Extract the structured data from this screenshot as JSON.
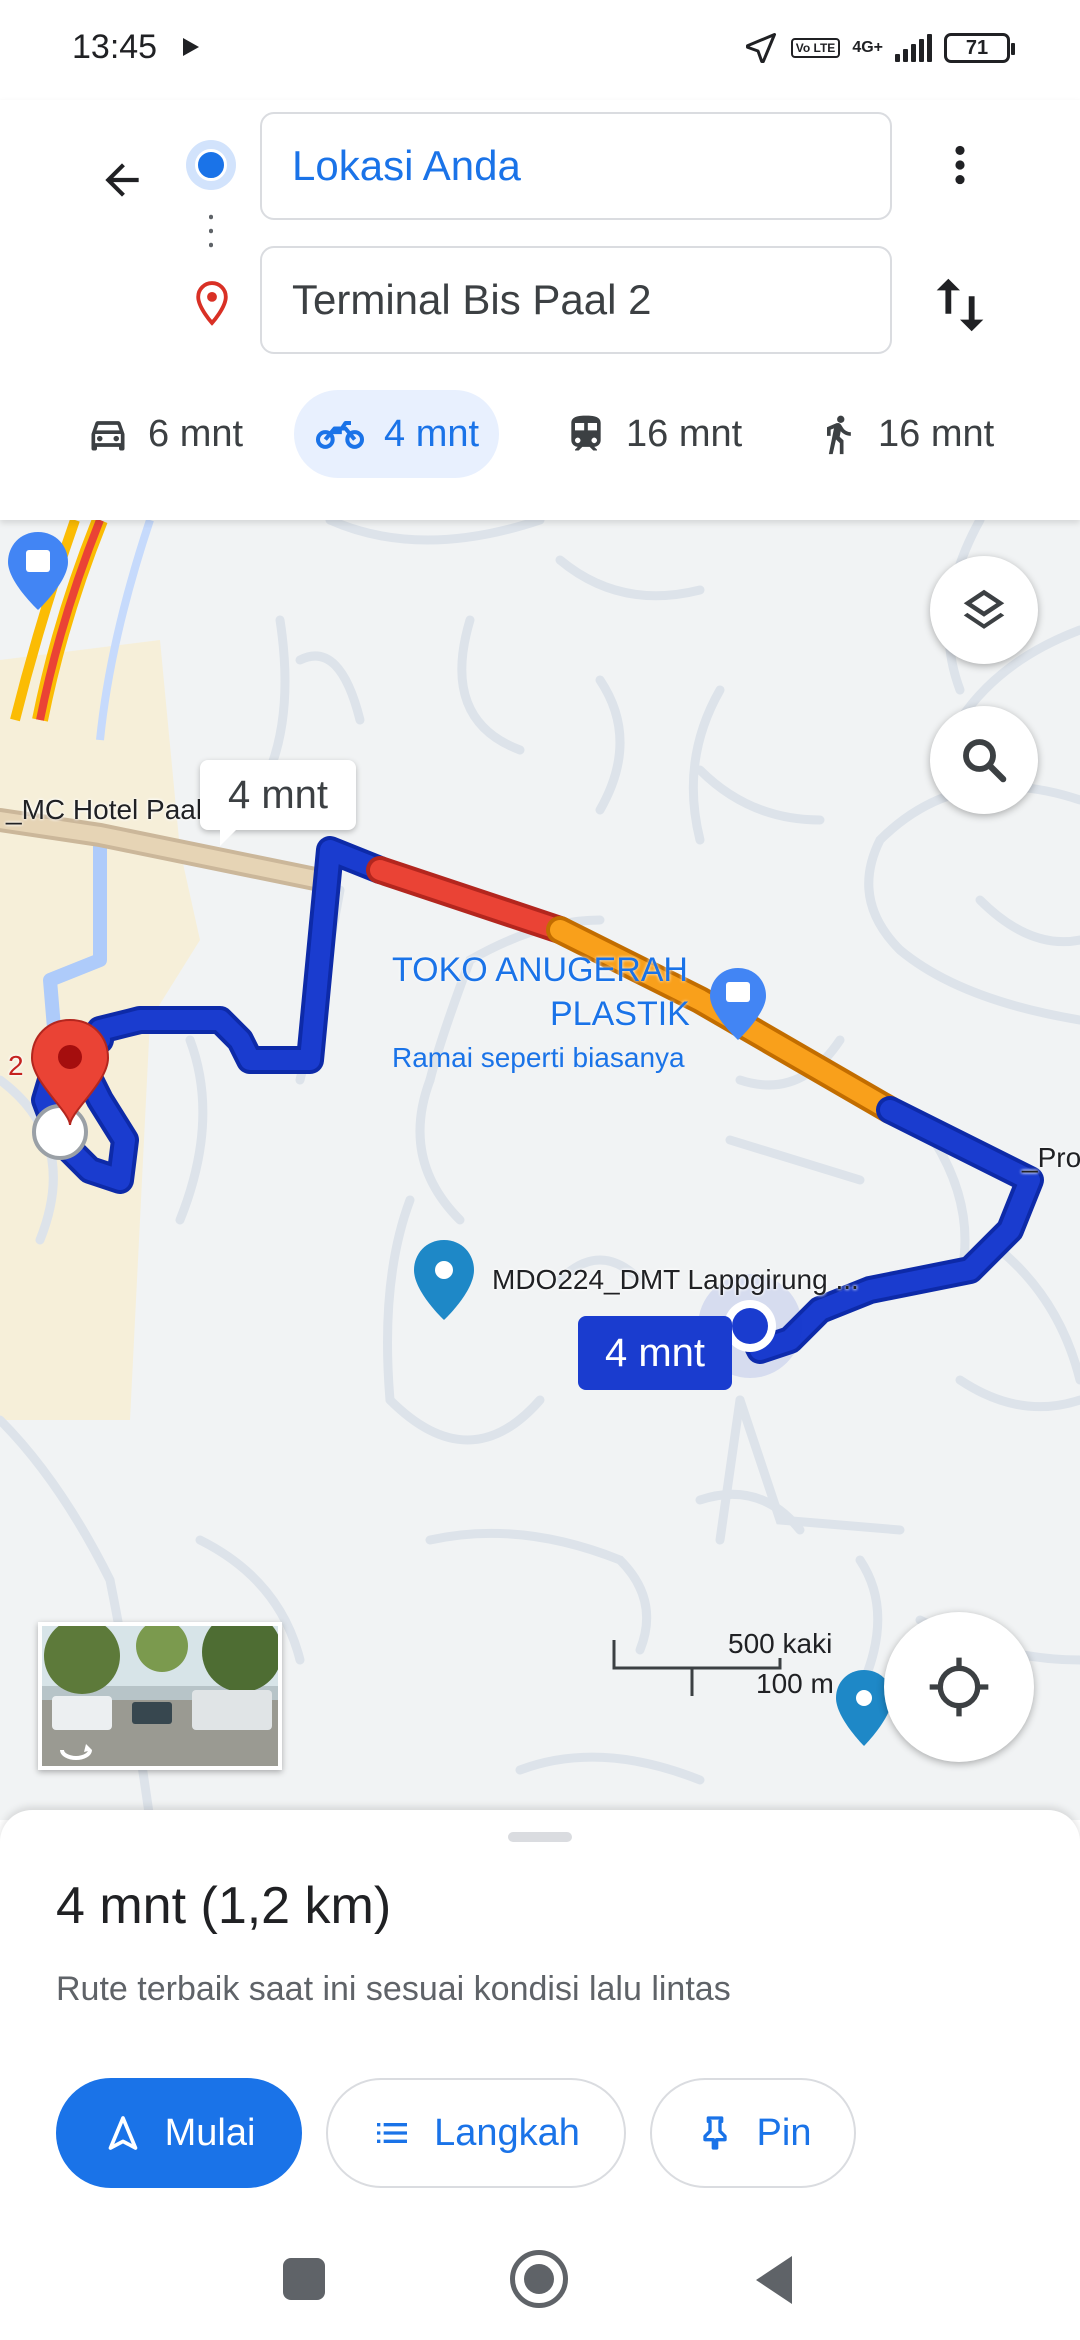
{
  "status_bar": {
    "time": "13:45",
    "battery": "71",
    "network": "4G+",
    "volte": "Vo LTE"
  },
  "directions": {
    "origin": "Lokasi Anda",
    "destination": "Terminal Bis Paal 2"
  },
  "modes": [
    {
      "icon": "car-icon",
      "label": "6 mnt",
      "active": false
    },
    {
      "icon": "motorcycle-icon",
      "label": "4 mnt",
      "active": true
    },
    {
      "icon": "transit-icon",
      "label": "16 mnt",
      "active": false
    },
    {
      "icon": "walk-icon",
      "label": "16 mnt",
      "active": false
    }
  ],
  "map": {
    "hotel_label": "_MC Hotel Paal",
    "route_tooltip_alt": "4 mnt",
    "route_tooltip_main": "4 mnt",
    "poi_name_line1": "TOKO ANUGERAH",
    "poi_name_line2": "PLASTIK",
    "poi_status": "Ramai seperti biasanya",
    "place_label": "MDO224_DMT Lappgirung ...",
    "edge_label_left": "2",
    "edge_label_right": "_Pro",
    "scale_imperial": "500 kaki",
    "scale_metric": "100 m"
  },
  "sheet": {
    "summary": "4 mnt (1,2 km)",
    "subtitle": "Rute terbaik saat ini sesuai kondisi lalu lintas",
    "start_label": "Mulai",
    "steps_label": "Langkah",
    "pin_label": "Pin"
  },
  "colors": {
    "accent": "#1a73e8",
    "route_fast": "#1a3ccf",
    "route_slow": "#ea4335",
    "route_medium": "#f9a01b"
  }
}
